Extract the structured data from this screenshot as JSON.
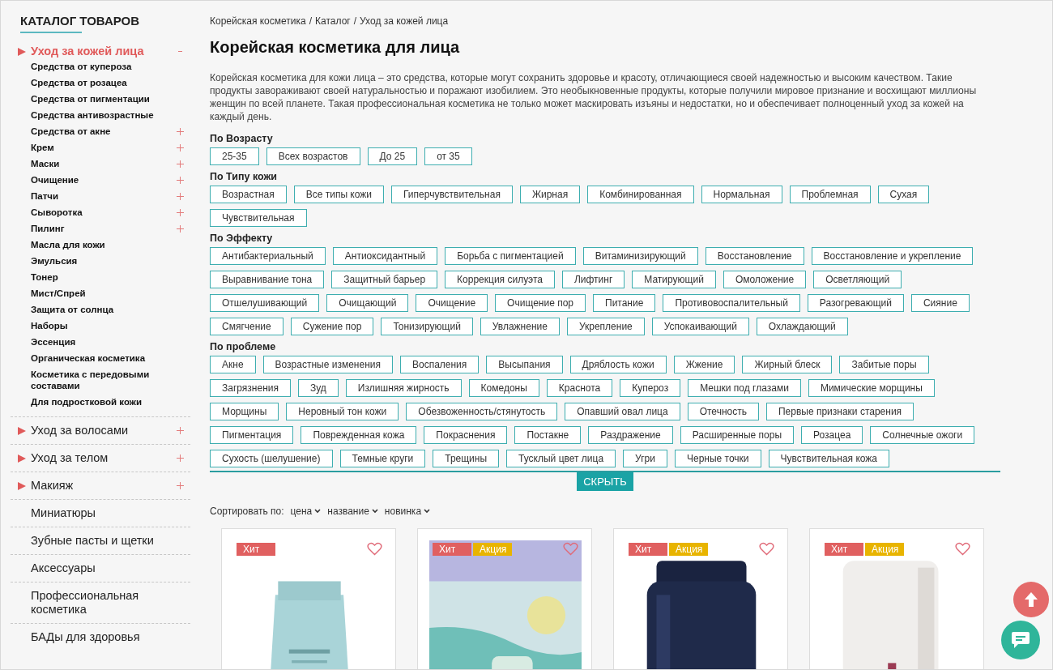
{
  "sidebar": {
    "title": "КАТАЛОГ ТОВАРОВ",
    "categories": [
      {
        "label": "Уход за кожей лица",
        "selected": true,
        "expanded": true,
        "children": [
          {
            "label": "Средства от купероза"
          },
          {
            "label": "Средства от розацеа"
          },
          {
            "label": "Средства от пигментации"
          },
          {
            "label": "Средства антивозрастные"
          },
          {
            "label": "Средства от акне",
            "expanded": false
          },
          {
            "label": "Крем",
            "expanded": false
          },
          {
            "label": "Маски",
            "expanded": false
          },
          {
            "label": "Очищение",
            "expanded": false
          },
          {
            "label": "Патчи",
            "expanded": false
          },
          {
            "label": "Сыворотка",
            "expanded": false
          },
          {
            "label": "Пилинг",
            "expanded": false
          },
          {
            "label": "Масла для кожи"
          },
          {
            "label": "Эмульсия"
          },
          {
            "label": "Тонер"
          },
          {
            "label": "Мист/Спрей"
          },
          {
            "label": "Защита от солнца"
          },
          {
            "label": "Наборы"
          },
          {
            "label": "Эссенция"
          },
          {
            "label": "Органическая косметика"
          },
          {
            "label": "Косметика с передовыми составами"
          },
          {
            "label": "Для подростковой кожи"
          }
        ]
      },
      {
        "label": "Уход за волосами",
        "selected": false,
        "expanded": false
      },
      {
        "label": "Уход за телом",
        "selected": false,
        "expanded": false
      },
      {
        "label": "Макияж",
        "selected": false,
        "expanded": false
      },
      {
        "label": "Миниатюры",
        "selected": false
      },
      {
        "label": "Зубные пасты и щетки",
        "selected": false
      },
      {
        "label": "Аксессуары",
        "selected": false
      },
      {
        "label": "Профессиональная косметика",
        "selected": false
      },
      {
        "label": "БАДы для здоровья",
        "selected": false
      }
    ]
  },
  "breadcrumb": {
    "separator": "/",
    "items": [
      "Корейская косметика",
      "Каталог",
      "Уход за кожей лица"
    ]
  },
  "title": "Корейская косметика для лица",
  "description": "Корейская косметика для кожи лица – это средства, которые могут сохранить здоровье и красоту, отличающиеся своей надежностью и высоким качеством. Такие продукты завораживают своей натуральностью и поражают изобилием. Это необыкновенные продукты, которые получили мировое признание и восхищают миллионы женщин по всей планете. Такая профессиональная косметика не только может маскировать изъяны и недостатки, но и обеспечивает полноценный уход за кожей на каждый день.",
  "filters": [
    {
      "title": "По Возрасту",
      "options": [
        "25-35",
        "Всех возрастов",
        "До 25",
        "от 35"
      ]
    },
    {
      "title": "По Типу кожи",
      "options": [
        "Возрастная",
        "Все типы кожи",
        "Гиперчувствительная",
        "Жирная",
        "Комбинированная",
        "Нормальная",
        "Проблемная",
        "Сухая",
        "Чувствительная"
      ]
    },
    {
      "title": "По Эффекту",
      "options": [
        "Антибактериальный",
        "Антиоксидантный",
        "Борьба с пигментацией",
        "Витаминизирующий",
        "Восстановление",
        "Восстановление и укрепление",
        "Выравнивание тона",
        "Защитный барьер",
        "Коррекция силуэта",
        "Лифтинг",
        "Матирующий",
        "Омоложение",
        "Осветляющий",
        "Отшелушивающий",
        "Очищающий",
        "Очищение",
        "Очищение пор",
        "Питание",
        "Противовоспалительный",
        "Разогревающий",
        "Сияние",
        "Смягчение",
        "Сужение пор",
        "Тонизирующий",
        "Увлажнение",
        "Укрепление",
        "Успокаивающий",
        "Охлаждающий"
      ]
    },
    {
      "title": "По проблеме",
      "options": [
        "Акне",
        "Возрастные изменения",
        "Воспаления",
        "Высыпания",
        "Дряблость кожи",
        "Жжение",
        "Жирный блеск",
        "Забитые поры",
        "Загрязнения",
        "Зуд",
        "Излишняя жирность",
        "Комедоны",
        "Краснота",
        "Купероз",
        "Мешки под глазами",
        "Мимические морщины",
        "Морщины",
        "Неровный тон кожи",
        "Обезвоженность/стянутость",
        "Опавший овал лица",
        "Отечность",
        "Первые признаки старения",
        "Пигментация",
        "Поврежденная кожа",
        "Покраснения",
        "Постакне",
        "Раздражение",
        "Расширенные поры",
        "Розацеа",
        "Солнечные ожоги",
        "Сухость (шелушение)",
        "Темные круги",
        "Трещины",
        "Тусклый цвет лица",
        "Угри",
        "Черные точки",
        "Чувствительная кожа"
      ]
    }
  ],
  "hide_button": "СКРЫТЬ",
  "sort": {
    "label": "Сортировать по:",
    "options": [
      "цена",
      "название",
      "новинка"
    ]
  },
  "products": [
    {
      "badges": [
        {
          "kind": "hit",
          "label": "Хит"
        }
      ],
      "image": {
        "kind": "picture"
      }
    },
    {
      "badges": [
        {
          "kind": "hit",
          "label": "Хит"
        },
        {
          "kind": "sale",
          "label": "Акция"
        }
      ],
      "image": {
        "kind": "picture"
      }
    },
    {
      "badges": [
        {
          "kind": "hit",
          "label": "Хит"
        },
        {
          "kind": "sale",
          "label": "Акция"
        }
      ],
      "image": {
        "kind": "picture"
      }
    },
    {
      "badges": [
        {
          "kind": "hit",
          "label": "Хит"
        },
        {
          "kind": "sale",
          "label": "Акция"
        }
      ],
      "image": {
        "kind": "picture"
      }
    }
  ]
}
